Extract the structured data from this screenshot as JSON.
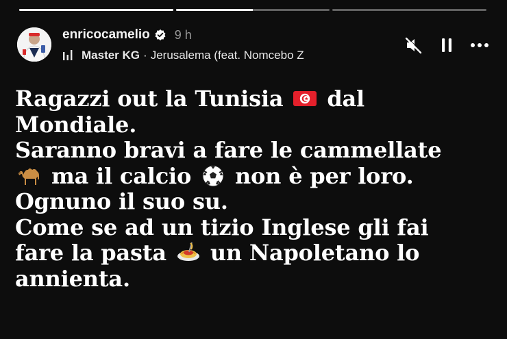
{
  "story": {
    "progress_segments": [
      1.0,
      0.5,
      0.0
    ],
    "progress_color": "#ffffff"
  },
  "header": {
    "username": "enricocamelio",
    "time": "9 h",
    "music": {
      "artist": "Master KG",
      "separator": "·",
      "song": "Jerusalema (feat. Nomcebo Z"
    },
    "icons": [
      "verified-badge-icon",
      "music-bars-icon",
      "mute-icon",
      "pause-icon",
      "more-icon"
    ]
  },
  "content": {
    "lines": [
      {
        "parts": [
          {
            "text": "Ragazzi out la Tunisia "
          },
          {
            "emoji": "flag-tunisia"
          },
          {
            "text": " dal"
          }
        ]
      },
      {
        "parts": [
          {
            "text": "Mondiale."
          }
        ]
      },
      {
        "parts": [
          {
            "text": "Saranno bravi a fare le cammellate"
          }
        ]
      },
      {
        "parts": [
          {
            "emoji": "camel"
          },
          {
            "text": " ma il calcio "
          },
          {
            "emoji": "soccer-ball"
          },
          {
            "text": " non è per loro."
          }
        ]
      },
      {
        "parts": [
          {
            "text": "Ognuno il suo su."
          }
        ]
      },
      {
        "parts": [
          {
            "text": "Come se ad un tizio Inglese gli fai"
          }
        ]
      },
      {
        "parts": [
          {
            "text": "fare la pasta "
          },
          {
            "emoji": "spaghetti"
          },
          {
            "text": " un Napoletano lo"
          }
        ]
      },
      {
        "parts": [
          {
            "text": "annienta."
          }
        ]
      }
    ],
    "text_color": "#ffffff",
    "background": "#0d0d0d"
  }
}
